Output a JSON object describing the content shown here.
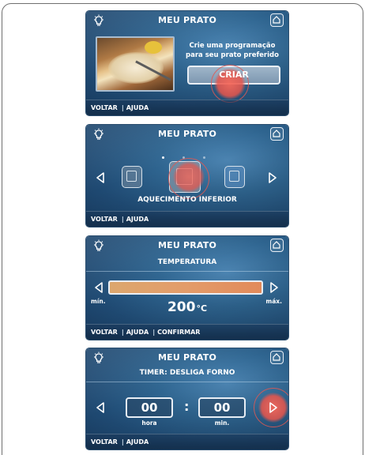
{
  "colors": {
    "screen_bg": "#2f6590",
    "touch_accent": "#e8554b",
    "temperature_bar": "#e39c6a"
  },
  "screens": [
    {
      "title": "MEU PRATO",
      "promo_line1": "Crie uma programação",
      "promo_line2": "para seu prato preferido",
      "button_label": "CRIAR",
      "footer": {
        "back": "VOLTAR",
        "separator": "|",
        "help": "AJUDA"
      }
    },
    {
      "title": "MEU PRATO",
      "mode_label": "AQUECIMENTO INFERIOR",
      "page_indicator": {
        "count": 3,
        "active": 1
      },
      "footer": {
        "back": "VOLTAR",
        "separator": "|",
        "help": "AJUDA"
      }
    },
    {
      "title": "MEU PRATO",
      "subtitle": "TEMPERATURA",
      "min_label": "mín.",
      "max_label": "máx.",
      "temperature_value": "200",
      "temperature_unit": "°C",
      "footer": {
        "back": "VOLTAR",
        "separator": "|",
        "help": "AJUDA",
        "separator2": "|",
        "confirm": "CONFIRMAR"
      }
    },
    {
      "title": "MEU PRATO",
      "subtitle": "TIMER: DESLIGA FORNO",
      "hours_value": "00",
      "hours_label": "hora",
      "colon": ":",
      "minutes_value": "00",
      "minutes_label": "min.",
      "footer": {
        "back": "VOLTAR",
        "separator": "|",
        "help": "AJUDA"
      }
    }
  ]
}
